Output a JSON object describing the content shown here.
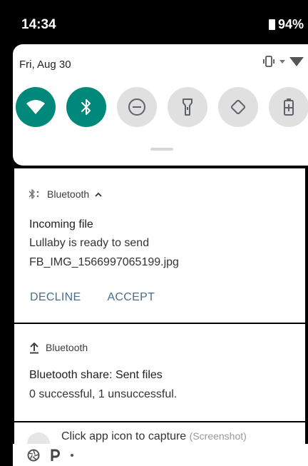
{
  "status_bar": {
    "time": "14:34",
    "battery_text": "94%"
  },
  "quick_settings": {
    "date": "Fri, Aug 30",
    "tiles": [
      {
        "name": "wifi",
        "active": true
      },
      {
        "name": "bluetooth",
        "active": true
      },
      {
        "name": "do-not-disturb",
        "active": false
      },
      {
        "name": "flashlight",
        "active": false
      },
      {
        "name": "auto-rotate",
        "active": false
      },
      {
        "name": "battery-saver",
        "active": false
      }
    ],
    "accent_color": "#00897b"
  },
  "notifications": [
    {
      "app": "Bluetooth",
      "title": "Incoming file",
      "lines": [
        "Lullaby is ready to send",
        "FB_IMG_1566997065199.jpg"
      ],
      "actions": [
        "DECLINE",
        "ACCEPT"
      ]
    },
    {
      "app": "Bluetooth",
      "title": "Bluetooth share: Sent files",
      "lines": [
        "0 successful, 1 unsuccessful."
      ]
    },
    {
      "text": "Click app icon to capture",
      "sub": "(Screenshot)"
    }
  ]
}
